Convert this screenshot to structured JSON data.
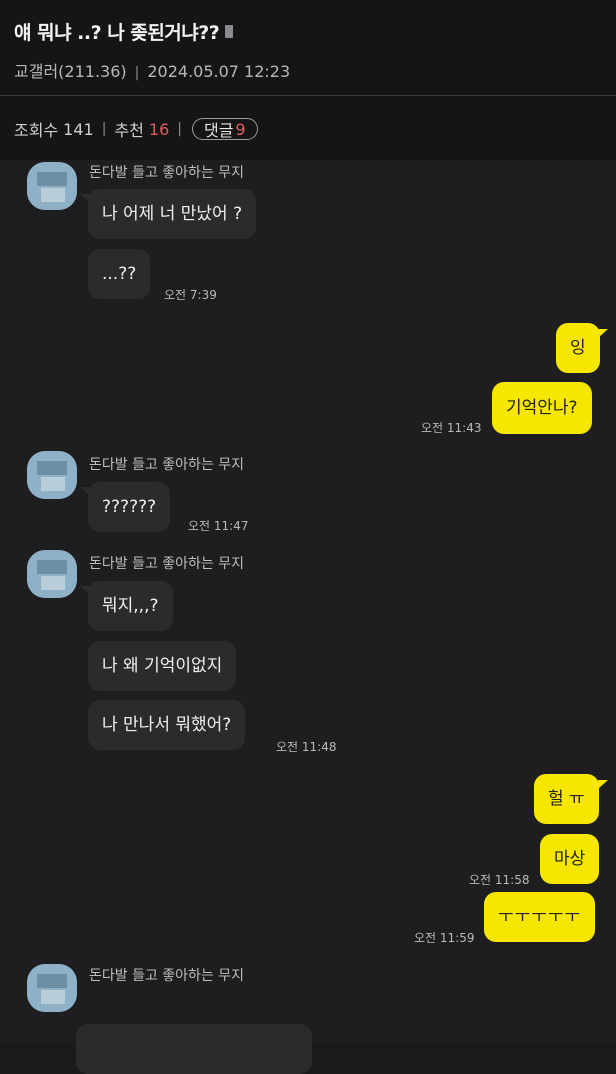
{
  "post": {
    "title": "얘 뭐냐 ..? 나 좆된거냐??",
    "author": "교갤러(211.36)",
    "date": "2024.05.07 12:23",
    "views_label": "조회수",
    "views": "141",
    "recommend_label": "추천",
    "recommend": "16",
    "comments_label": "댓글",
    "comments": "9"
  },
  "chat": {
    "sender_name": "돈다발 들고 좋아하는 무지",
    "messages": [
      {
        "from": "other",
        "text": "나 어제 너 만났어 ?"
      },
      {
        "from": "other",
        "text": "...??",
        "time": "오전 7:39"
      },
      {
        "from": "me",
        "text": "잉"
      },
      {
        "from": "me",
        "text": "기억안나?",
        "time": "오전 11:43"
      },
      {
        "from": "other",
        "text": "??????",
        "time": "오전 11:47"
      },
      {
        "from": "other",
        "text": "뭐지,,,?"
      },
      {
        "from": "other",
        "text": "나 왜 기억이없지"
      },
      {
        "from": "other",
        "text": "나 만나서 뭐했어?",
        "time": "오전 11:48"
      },
      {
        "from": "me",
        "text": "헐 ㅠ"
      },
      {
        "from": "me",
        "text": "마상",
        "time": "오전 11:58"
      },
      {
        "from": "me",
        "text": "ㅜㅜㅜㅜㅜ",
        "time": "오전 11:59"
      }
    ]
  },
  "colors": {
    "my_bubble": "#f7e600",
    "other_bubble": "#2b2b2d",
    "accent_red": "#e35f5f"
  }
}
